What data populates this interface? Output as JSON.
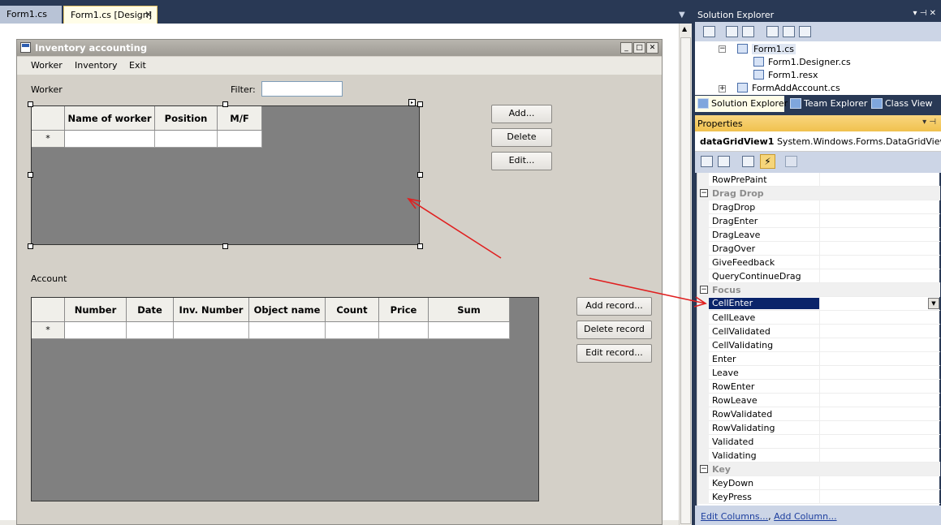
{
  "tabs": [
    {
      "label": "Form1.cs"
    },
    {
      "label": "Form1.cs [Design]"
    }
  ],
  "form": {
    "title": "Inventory accounting",
    "menu": [
      "Worker",
      "Inventory",
      "Exit"
    ],
    "worker_label": "Worker",
    "filter_label": "Filter:",
    "filter_value": "",
    "worker_grid": {
      "columns": [
        "Name of worker",
        "Position",
        "M/F"
      ],
      "new_row_marker": "*"
    },
    "worker_buttons": [
      "Add...",
      "Delete",
      "Edit..."
    ],
    "account_label": "Account",
    "account_grid": {
      "columns": [
        "Number",
        "Date",
        "Inv. Number",
        "Object name",
        "Count",
        "Price",
        "Sum"
      ],
      "new_row_marker": "*"
    },
    "account_buttons": [
      "Add record...",
      "Delete record",
      "Edit record..."
    ]
  },
  "solution_explorer": {
    "title": "Solution Explorer",
    "tree": [
      "Form1.cs",
      "Form1.Designer.cs",
      "Form1.resx",
      "FormAddAccount.cs"
    ],
    "tabs": [
      "Solution Explorer",
      "Team Explorer",
      "Class View"
    ]
  },
  "properties": {
    "title": "Properties",
    "object_name": "dataGridView1",
    "object_type": "System.Windows.Forms.DataGridView",
    "rows": [
      {
        "kind": "prop",
        "name": "RowPrePaint"
      },
      {
        "kind": "cat",
        "name": "Drag Drop"
      },
      {
        "kind": "prop",
        "name": "DragDrop"
      },
      {
        "kind": "prop",
        "name": "DragEnter"
      },
      {
        "kind": "prop",
        "name": "DragLeave"
      },
      {
        "kind": "prop",
        "name": "DragOver"
      },
      {
        "kind": "prop",
        "name": "GiveFeedback"
      },
      {
        "kind": "prop",
        "name": "QueryContinueDrag"
      },
      {
        "kind": "cat",
        "name": "Focus"
      },
      {
        "kind": "sel",
        "name": "CellEnter"
      },
      {
        "kind": "prop",
        "name": "CellLeave"
      },
      {
        "kind": "prop",
        "name": "CellValidated"
      },
      {
        "kind": "prop",
        "name": "CellValidating"
      },
      {
        "kind": "prop",
        "name": "Enter"
      },
      {
        "kind": "prop",
        "name": "Leave"
      },
      {
        "kind": "prop",
        "name": "RowEnter"
      },
      {
        "kind": "prop",
        "name": "RowLeave"
      },
      {
        "kind": "prop",
        "name": "RowValidated"
      },
      {
        "kind": "prop",
        "name": "RowValidating"
      },
      {
        "kind": "prop",
        "name": "Validated"
      },
      {
        "kind": "prop",
        "name": "Validating"
      },
      {
        "kind": "cat",
        "name": "Key"
      },
      {
        "kind": "prop",
        "name": "KeyDown"
      },
      {
        "kind": "prop",
        "name": "KeyPress"
      }
    ],
    "footer_links": [
      "Edit Columns...",
      "Add Column..."
    ]
  },
  "colors": {
    "vs_background": "#293955",
    "form_background": "#d4d0c8",
    "grid_background": "#808080",
    "selection": "#0a246a",
    "annotation_arrow": "#e02020"
  }
}
